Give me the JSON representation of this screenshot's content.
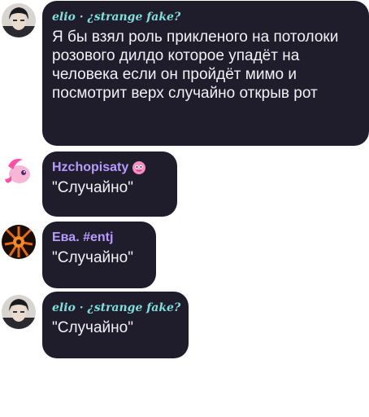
{
  "messages": [
    {
      "author": "elio · ¿strange fake?",
      "text": "Я бы взял роль прикленого на потолоки розового дилдо которое упадёт на человека если он пройдёт мимо и посмотрит верх случайно открыв рот"
    },
    {
      "author": "Hzchopisaty",
      "text": "\"Случайно\""
    },
    {
      "author": "Ева. #entj",
      "text": "\"Случайно\""
    },
    {
      "author": "elio · ¿strange fake?",
      "text": "\"Случайно\""
    }
  ],
  "colors": {
    "bubble": "#1f1c2b",
    "name_gothic": "#7ee0dc",
    "name_purple": "#b79bff",
    "text": "#f2f1f5"
  }
}
